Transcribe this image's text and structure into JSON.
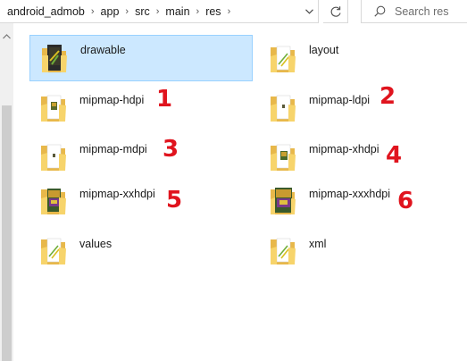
{
  "breadcrumb": {
    "items": [
      "android_admob",
      "app",
      "src",
      "main",
      "res"
    ]
  },
  "search": {
    "placeholder": "Search res"
  },
  "folders": [
    {
      "name": "drawable",
      "selected": true,
      "preview": "image-dark"
    },
    {
      "name": "layout",
      "selected": false,
      "preview": "doc-green"
    },
    {
      "name": "mipmap-hdpi",
      "selected": false,
      "preview": "icon-small"
    },
    {
      "name": "mipmap-ldpi",
      "selected": false,
      "preview": "icon-tiny"
    },
    {
      "name": "mipmap-mdpi",
      "selected": false,
      "preview": "icon-tiny"
    },
    {
      "name": "mipmap-xhdpi",
      "selected": false,
      "preview": "icon-small"
    },
    {
      "name": "mipmap-xxhdpi",
      "selected": false,
      "preview": "icon-large"
    },
    {
      "name": "mipmap-xxxhdpi",
      "selected": false,
      "preview": "icon-large"
    },
    {
      "name": "values",
      "selected": false,
      "preview": "doc-green"
    },
    {
      "name": "xml",
      "selected": false,
      "preview": "doc-green"
    }
  ],
  "annotations": [
    "1",
    "2",
    "3",
    "4",
    "5",
    "6"
  ],
  "colors": {
    "selection": "#cce8ff",
    "selection_border": "#99d1ff",
    "folder": "#f7d46b",
    "annotation": "#e0141e"
  }
}
